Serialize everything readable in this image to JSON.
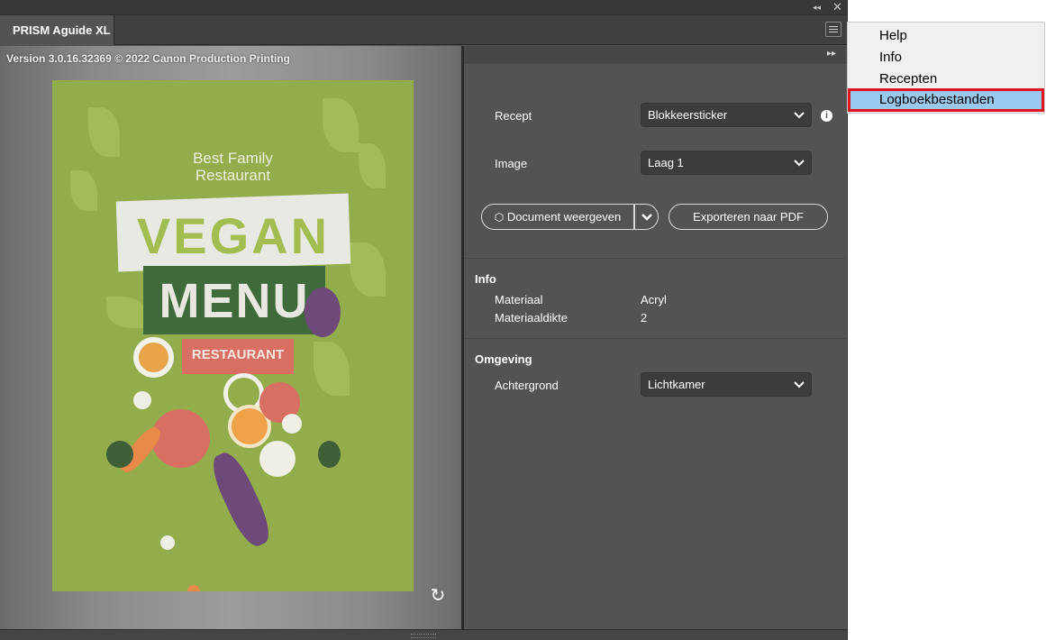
{
  "window": {
    "collapse_glyph": "◂◂",
    "close_glyph": "✕"
  },
  "tab": {
    "title": "PRISM Aguide XL"
  },
  "preview": {
    "version_text": "Version 3.0.16.32369 © 2022 Canon Production Printing",
    "poster": {
      "line1": "Best Family",
      "line2": "Restaurant",
      "headline1": "VEGAN",
      "headline2": "MENU",
      "tag": "RESTAURANT"
    },
    "refresh_glyph": "↻"
  },
  "settings": {
    "expand_glyph": "▸▸",
    "recept": {
      "label": "Recept",
      "value": "Blokkeersticker"
    },
    "image": {
      "label": "Image",
      "value": "Laag 1"
    },
    "document_button": "Document weergeven",
    "export_button": "Exporteren naar PDF",
    "info": {
      "heading": "Info",
      "rows": [
        {
          "label": "Materiaal",
          "value": "Acryl"
        },
        {
          "label": "Materiaaldikte",
          "value": "2"
        }
      ]
    },
    "omgeving": {
      "heading": "Omgeving",
      "label": "Achtergrond",
      "value": "Lichtkamer"
    }
  },
  "flyout": {
    "items": [
      "Help",
      "Info",
      "Recepten",
      "Logboekbestanden"
    ],
    "highlighted": "Logboekbestanden"
  },
  "colors": {
    "panel": "#535353",
    "highlight": "#99c9ef",
    "highlight_border": "#e0131f",
    "poster_green": "#93ad4c"
  }
}
